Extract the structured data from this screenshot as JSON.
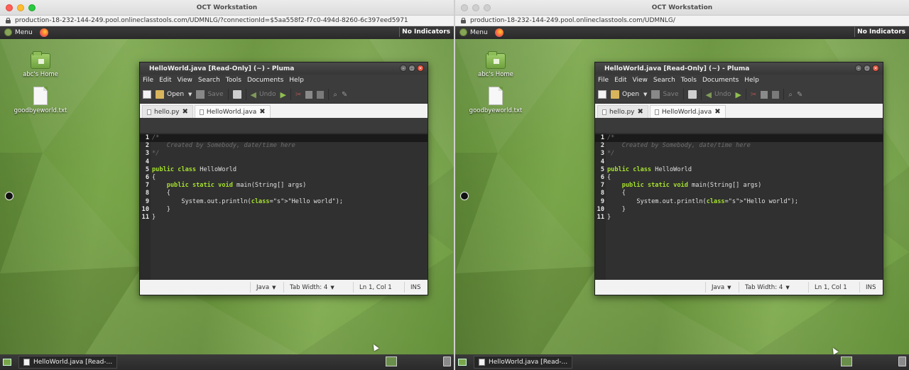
{
  "workstation_title": "OCT Workstation",
  "left_url": "production-18-232-144-249.pool.onlineclasstools.com/UDMNLG/?connectionId=$5aa558f2-f7c0-494d-8260-6c397eed5971",
  "right_url": "production-18-232-144-249.pool.onlineclasstools.com/UDMNLG/",
  "panel": {
    "menu_label": "Menu",
    "indicators_label": "No Indicators"
  },
  "desktop": {
    "home_label": "abc's Home",
    "file_label": "goodbyeworld.txt"
  },
  "window": {
    "title": "HelloWorld.java [Read-Only] (~) - Pluma",
    "menu": [
      "File",
      "Edit",
      "View",
      "Search",
      "Tools",
      "Documents",
      "Help"
    ],
    "toolbar": {
      "open": "Open",
      "save": "Save",
      "undo": "Undo"
    },
    "tabs": [
      {
        "label": "hello.py"
      },
      {
        "label": "HelloWorld.java"
      }
    ],
    "code": [
      {
        "n": "1",
        "t": "/*"
      },
      {
        "n": "2",
        "t": "    Created by Somebody, date/time here"
      },
      {
        "n": "3",
        "t": "*/"
      },
      {
        "n": "4",
        "t": ""
      },
      {
        "n": "5",
        "t": "public class HelloWorld"
      },
      {
        "n": "6",
        "t": "{"
      },
      {
        "n": "7",
        "t": "    public static void main(String[] args)"
      },
      {
        "n": "8",
        "t": "    {"
      },
      {
        "n": "9",
        "t": "        System.out.println(\"Hello world\");"
      },
      {
        "n": "10",
        "t": "    }"
      },
      {
        "n": "11",
        "t": "}"
      }
    ],
    "status": {
      "language": "Java",
      "tab_width": "Tab Width: 4",
      "position": "Ln 1, Col 1",
      "mode": "INS"
    }
  },
  "taskbar": {
    "task_label": "HelloWorld.java [Read-..."
  }
}
